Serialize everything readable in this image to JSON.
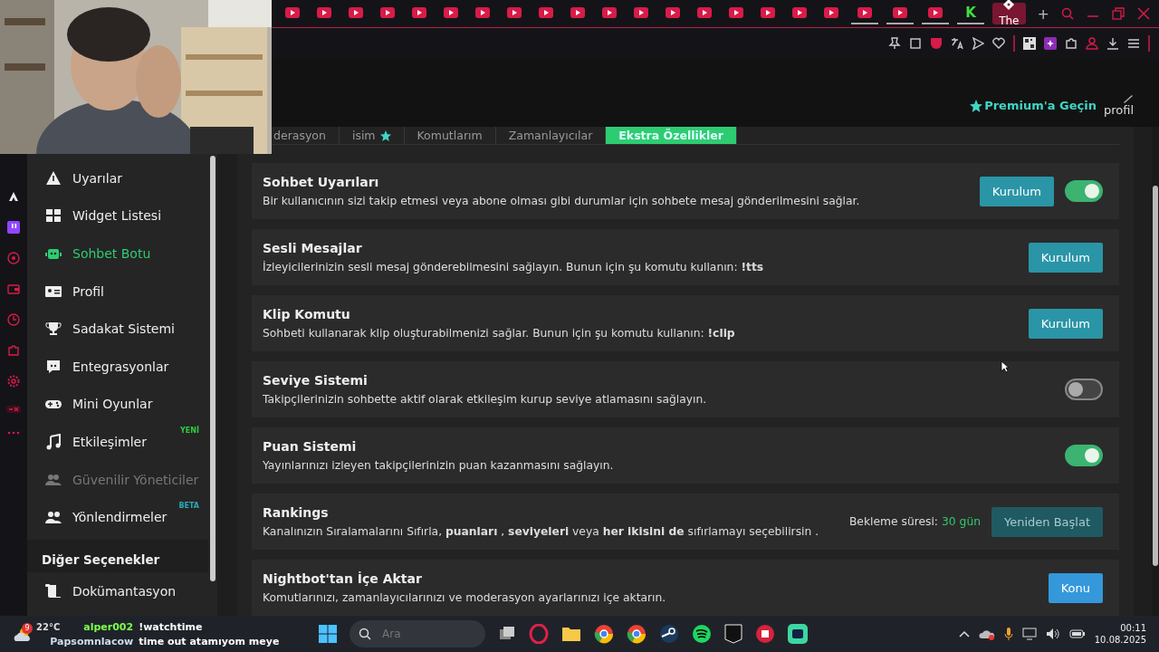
{
  "browser": {
    "tabs": [
      {
        "kind": "video",
        "selected": false,
        "marked": false
      },
      {
        "kind": "video",
        "selected": false,
        "marked": false
      },
      {
        "kind": "video",
        "selected": false,
        "marked": false
      },
      {
        "kind": "video",
        "selected": false,
        "marked": false
      },
      {
        "kind": "video",
        "selected": false,
        "marked": false
      },
      {
        "kind": "video",
        "selected": false,
        "marked": false
      },
      {
        "kind": "video",
        "selected": false,
        "marked": false
      },
      {
        "kind": "video",
        "selected": false,
        "marked": false
      },
      {
        "kind": "video",
        "selected": false,
        "marked": false
      },
      {
        "kind": "video",
        "selected": false,
        "marked": false
      },
      {
        "kind": "video",
        "selected": false,
        "marked": false
      },
      {
        "kind": "video",
        "selected": false,
        "marked": false
      },
      {
        "kind": "video",
        "selected": false,
        "marked": false
      },
      {
        "kind": "video",
        "selected": false,
        "marked": false
      },
      {
        "kind": "video",
        "selected": false,
        "marked": false
      },
      {
        "kind": "video",
        "selected": false,
        "marked": false
      },
      {
        "kind": "video",
        "selected": false,
        "marked": false
      },
      {
        "kind": "video",
        "selected": false,
        "marked": false
      },
      {
        "kind": "video",
        "selected": false,
        "marked": true
      },
      {
        "kind": "video",
        "selected": false,
        "marked": true
      },
      {
        "kind": "video",
        "selected": false,
        "marked": true
      },
      {
        "kind": "letter",
        "label": "K",
        "selected": false,
        "marked": true
      },
      {
        "kind": "page",
        "label": "The",
        "selected": true,
        "marked": false
      }
    ],
    "new_tab": "+"
  },
  "header": {
    "premium": "Premium'a Geçin",
    "profile": "profil"
  },
  "sidebar": {
    "items": [
      {
        "label": "Uyarılar",
        "selected": false,
        "disabled": false
      },
      {
        "label": "Widget Listesi",
        "selected": false,
        "disabled": false
      },
      {
        "label": "Sohbet Botu",
        "selected": true,
        "disabled": false
      },
      {
        "label": "Profil",
        "selected": false,
        "disabled": false
      },
      {
        "label": "Sadakat Sistemi",
        "selected": false,
        "disabled": false
      },
      {
        "label": "Entegrasyonlar",
        "selected": false,
        "disabled": false
      },
      {
        "label": "Mini Oyunlar",
        "selected": false,
        "disabled": false
      },
      {
        "label": "Etkileşimler",
        "selected": false,
        "disabled": false,
        "badge": {
          "text": "YENİ",
          "color": "#2ecc40"
        }
      },
      {
        "label": "Güvenilir Yöneticiler",
        "selected": false,
        "disabled": true
      },
      {
        "label": "Yönlendirmeler",
        "selected": false,
        "disabled": false,
        "badge": {
          "text": "BETA",
          "color": "#2aa9b5"
        }
      }
    ],
    "section": "Diğer Seçenekler",
    "extra_items": [
      {
        "label": "Dokümantasyon",
        "selected": false,
        "disabled": false
      }
    ]
  },
  "tabs": [
    {
      "label": "derasyon",
      "selected": false,
      "starred": false
    },
    {
      "label": "isim",
      "selected": false,
      "starred": true
    },
    {
      "label": "Komutlarım",
      "selected": false,
      "starred": false
    },
    {
      "label": "Zamanlayıcılar",
      "selected": false,
      "starred": false
    },
    {
      "label": "Ekstra Özellikler",
      "selected": true,
      "starred": false
    }
  ],
  "features": [
    {
      "title": "Sohbet Uyarıları",
      "description": "Bir kullanıcının sizi takip etmesi veya abone olması gibi durumlar için sohbete mesaj gönderilmesini sağlar.",
      "button": {
        "label": "Kurulum",
        "kind": "setup",
        "disabled": false
      },
      "toggle": {
        "on": true
      }
    },
    {
      "title": "Sesli Mesajlar",
      "description": "İzleyicilerinizin sesli mesaj gönderebilmesini sağlayın. Bunun için şu komutu kullanın:  **!tts**",
      "button": {
        "label": "Kurulum",
        "kind": "setup",
        "disabled": false
      }
    },
    {
      "title": "Klip Komutu",
      "description": "Sohbeti kullanarak klip oluşturabilmenizi sağlar. Bunun için şu komutu kullanın: **!clip**",
      "button": {
        "label": "Kurulum",
        "kind": "setup",
        "disabled": false
      }
    },
    {
      "title": "Seviye Sistemi",
      "description": "Takipçilerinizin sohbette aktif olarak etkileşim kurup seviye atlamasını sağlayın.",
      "toggle": {
        "on": false
      }
    },
    {
      "title": "Puan Sistemi",
      "description": "Yayınlarınızı izleyen takipçilerinizin puan kazanmasını sağlayın.",
      "toggle": {
        "on": true
      }
    },
    {
      "title": "Rankings",
      "description": "Kanalınızın Sıralamalarını Sıfırla, **puanları** , **seviyeleri** veya **her ikisini de** sıfırlamayı seçebilirsin .",
      "cooldown": {
        "label": "Bekleme süresi:",
        "value": "30 gün"
      },
      "button": {
        "label": "Yeniden Başlat",
        "kind": "reset",
        "disabled": true
      }
    },
    {
      "title": "Nightbot'tan İçe Aktar",
      "description": "Komutlarınızı, zamanlayıcılarınızı ve moderasyon ayarlarınızı içe aktarın.",
      "button": {
        "label": "Konu",
        "kind": "import",
        "disabled": false
      }
    }
  ],
  "taskbar": {
    "weather": {
      "temperature": "22°C",
      "badge": "9"
    },
    "chat": [
      {
        "user": "alper002",
        "message": "!watchtime"
      },
      {
        "user": "Papsomnlacow",
        "message": "time out atamıyom meye"
      }
    ],
    "search": {
      "placeholder": "Ara"
    },
    "time": "00:11",
    "date": "10.08.2025"
  }
}
